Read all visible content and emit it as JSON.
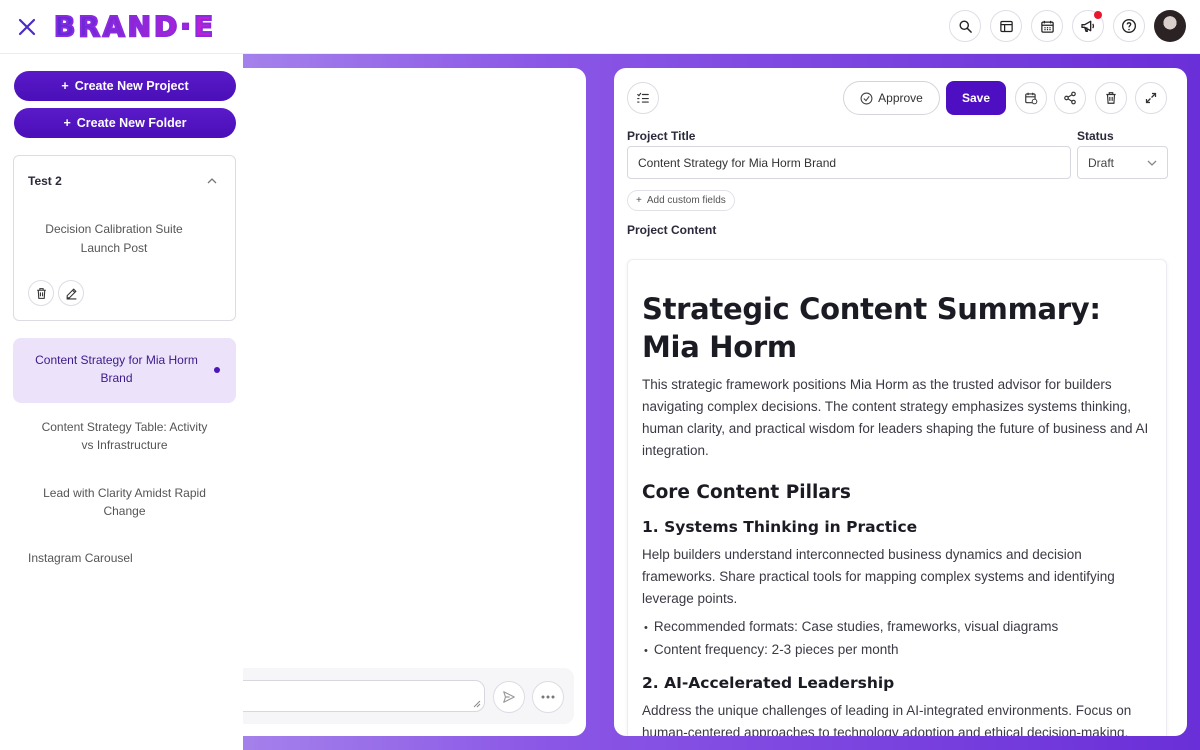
{
  "header": {
    "logo": "BRAND·E",
    "icons": [
      "search-icon",
      "layout-icon",
      "calendar-icon",
      "megaphone-icon",
      "help-icon"
    ]
  },
  "sidebar": {
    "create_project": "Create New Project",
    "create_folder": "Create New Folder",
    "folder": {
      "title": "Test 2",
      "item": "Decision Calibration Suite Launch Post"
    },
    "projects": [
      "Content Strategy for Mia Horm Brand",
      "Content Strategy Table: Activity vs Infrastructure",
      "Lead with Clarity Amidst Rapid Change",
      "Instagram Carousel"
    ]
  },
  "editor": {
    "approve": "Approve",
    "save": "Save",
    "project_title_label": "Project Title",
    "project_title_value": "Content Strategy for Mia Horm Brand",
    "status_label": "Status",
    "status_value": "Draft",
    "add_custom_fields": "Add custom fields",
    "project_content_label": "Project Content"
  },
  "document": {
    "h1": "Strategic Content Summary: Mia Horm",
    "intro": "This strategic framework positions Mia Horm as the trusted advisor for builders navigating complex decisions. The content strategy emphasizes systems thinking, human clarity, and practical wisdom for leaders shaping the future of business and AI integration.",
    "h2": "Core Content Pillars",
    "s1_title": "1. Systems Thinking in Practice",
    "s1_body": "Help builders understand interconnected business dynamics and decision frameworks. Share practical tools for mapping complex systems and identifying leverage points.",
    "s1_bullets": [
      "Recommended formats: Case studies, frameworks, visual diagrams",
      "Content frequency: 2-3 pieces per month"
    ],
    "s2_title": "2. AI-Accelerated Leadership",
    "s2_body": "Address the unique challenges of leading in AI-integrated environments. Focus on human-centered approaches to technology adoption and ethical decision-making."
  },
  "colors": {
    "brand_purple": "#4e0fc2",
    "accent_magenta": "#c71fd1",
    "notification_red": "#e8182f",
    "active_item_bg": "#ece3fb"
  }
}
